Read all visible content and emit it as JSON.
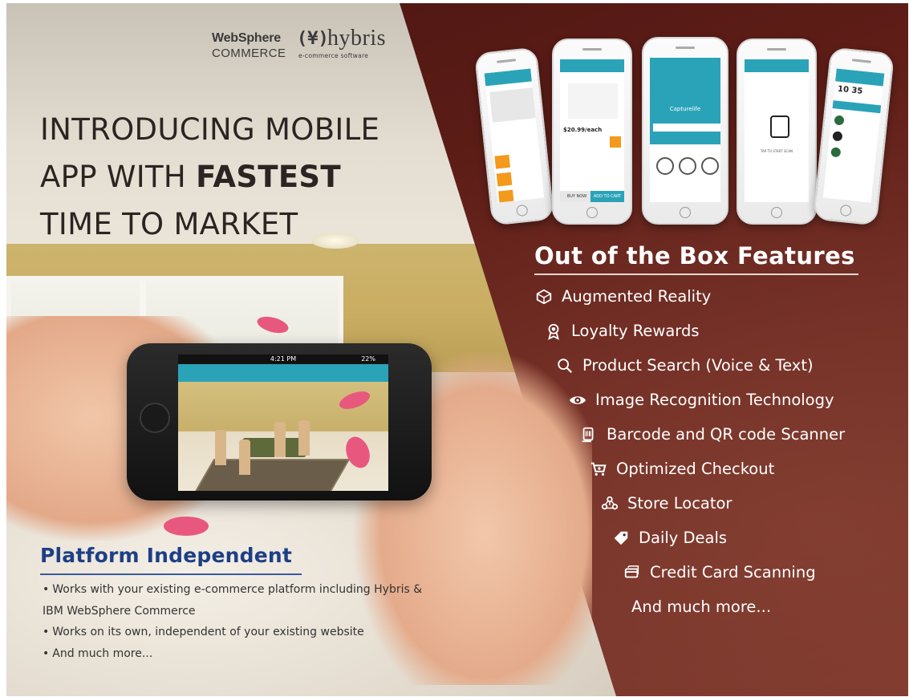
{
  "logos": {
    "websphere_line1": "WebSphere",
    "websphere_line2": "COMMERCE",
    "hybris_mark": "(¥)",
    "hybris_name": "hybris",
    "hybris_sub": "e-commerce software"
  },
  "headline": {
    "line1": "INTRODUCING MOBILE",
    "line2_prefix": "APP WITH ",
    "line2_bold": "FASTEST",
    "line3": "TIME TO MARKET"
  },
  "held_phone": {
    "time": "4:21 PM",
    "battery": "22%"
  },
  "platform": {
    "title": "Platform Independent",
    "bullets": [
      "Works with your existing e-commerce platform including Hybris &",
      "IBM WebSphere Commerce",
      "Works on its own, independent of your existing website",
      "And much more..."
    ]
  },
  "phones_row": {
    "phone2_price": "$20.99/each",
    "phone2_buy": "BUY NOW",
    "phone2_cart": "ADD TO CART",
    "phone3_brand": "Capturelife",
    "phone4_caption": "TAP TO START SCAN",
    "phone5_time": "10 35"
  },
  "features": {
    "title": "Out of the Box Features",
    "items": [
      {
        "label": "Augmented Reality",
        "icon": "cube-icon"
      },
      {
        "label": "Loyalty Rewards",
        "icon": "award-icon"
      },
      {
        "label": "Product Search (Voice & Text)",
        "icon": "search-icon"
      },
      {
        "label": "Image Recognition Technology",
        "icon": "eye-icon"
      },
      {
        "label": "Barcode and QR code Scanner",
        "icon": "barcode-scanner-icon"
      },
      {
        "label": "Optimized Checkout",
        "icon": "cart-icon"
      },
      {
        "label": "Store Locator",
        "icon": "store-locator-icon"
      },
      {
        "label": "Daily Deals",
        "icon": "tag-icon"
      },
      {
        "label": "Credit Card Scanning",
        "icon": "credit-card-icon"
      }
    ],
    "more": "And much more..."
  },
  "colors": {
    "maroon": "#5e1d17",
    "platform_blue": "#1d3f86",
    "app_teal": "#2aa3b8",
    "accent_orange": "#f39a1d",
    "nail_pink": "#e8587e"
  }
}
